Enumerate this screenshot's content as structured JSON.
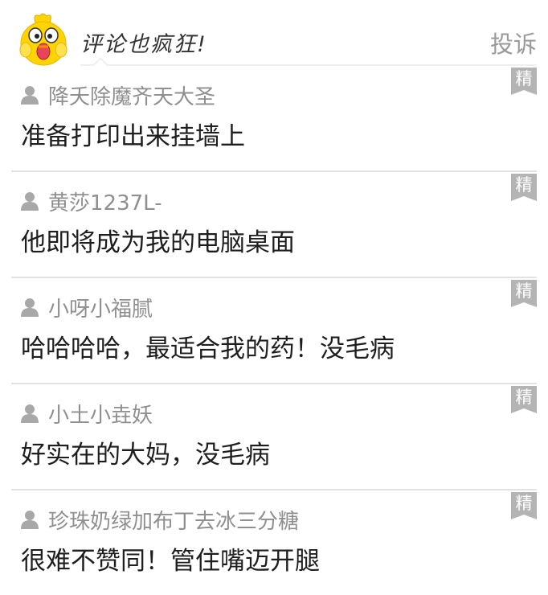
{
  "header": {
    "title": "评论也疯狂!",
    "report_label": "投诉"
  },
  "comments": [
    {
      "username": "降夭除魔齐天大圣",
      "text": "准备打印出来挂墙上",
      "badge": "精"
    },
    {
      "username": "黄莎1237L-",
      "text": "他即将成为我的电脑桌面",
      "badge": "精"
    },
    {
      "username": "小呀小福腻",
      "text": "哈哈哈哈，最适合我的药！没毛病",
      "badge": "精"
    },
    {
      "username": "小土小垚妖",
      "text": "好实在的大妈，没毛病",
      "badge": "精"
    },
    {
      "username": "珍珠奶绿加布丁去冰三分糖",
      "text": "很难不赞同！管住嘴迈开腿",
      "badge": "精"
    }
  ],
  "colors": {
    "badge_bg": "#b4b4b4",
    "username": "#8f8f8f",
    "mascot_yellow": "#ffd400",
    "divider": "#e2e2e2"
  }
}
